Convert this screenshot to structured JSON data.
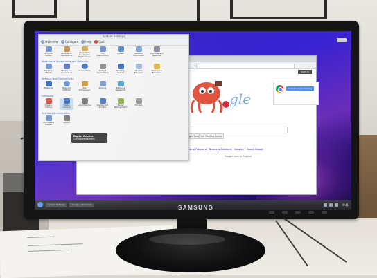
{
  "monitor": {
    "brand": "SAMSUNG"
  },
  "settings_window": {
    "title": "System Settings",
    "toolbar": {
      "overview": "Overview",
      "configure": "Configure",
      "help": "Help",
      "quit": "Quit"
    },
    "top_row": [
      "Account Details",
      "Application Appearance",
      "Application and System Notifications",
      "File Associations",
      "Locale",
      "Personal Information",
      "Shortcuts and Gestures"
    ],
    "sections": [
      {
        "title": "Workspace Appearance and Behavior",
        "items": [
          "Desktop Effects",
          "Workspace Appearance",
          "Accessibility",
          "Default Applications",
          "Desktop Search",
          "Window Behavior",
          "Workspace Behavior"
        ]
      },
      {
        "title": "Network and Connectivity",
        "items": [
          "Bluetooth",
          "Network Settings",
          "SSL Preferences",
          "Sharing",
          "Kerberos Passwords"
        ]
      },
      {
        "title": "Hardware",
        "items": [
          "Device Actions",
          "Digital Camera",
          "Input Devices",
          "Display and Monitor",
          "Power Management",
          "Printers"
        ]
      },
      {
        "title": "System Administration",
        "items": [
          "Permissions Tweaks",
          "Samba"
        ]
      }
    ],
    "tooltip": {
      "title": "Digital Camera",
      "subtitle": "Configure Kamera"
    }
  },
  "browser_window": {
    "sign_in": "Sign in",
    "doodle_text": "gle",
    "promo_button": "Install Google Chrome",
    "search_buttons": [
      "Google Search",
      "I'm Feeling Lucky"
    ],
    "links": [
      "Advertising Programs",
      "Business Solutions",
      "Google+",
      "About Google"
    ],
    "language_line": "Google.com in English"
  },
  "taskbar": {
    "tasks": [
      "System Settings",
      "Google - Chromium"
    ],
    "clock": "9:41"
  }
}
